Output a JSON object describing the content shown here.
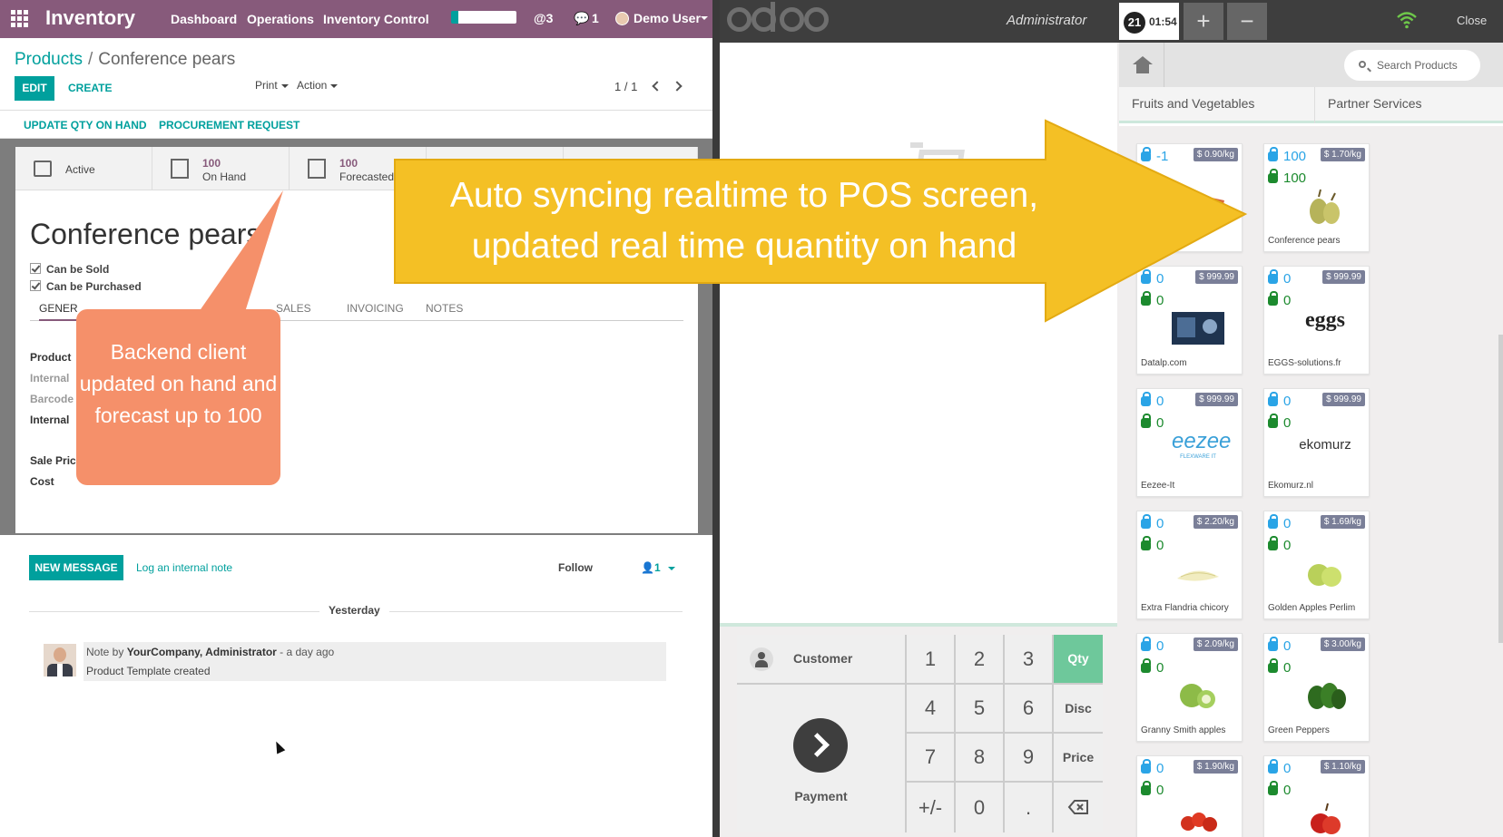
{
  "backend": {
    "app_name": "Inventory",
    "menu": [
      "Dashboard",
      "Operations",
      "Inventory Control"
    ],
    "mentions": "@3",
    "messages": "1",
    "user": "Demo User",
    "breadcrumb": {
      "parent": "Products",
      "separator": "/",
      "current": "Conference pears"
    },
    "buttons": {
      "edit": "EDIT",
      "create": "CREATE",
      "print": "Print",
      "action": "Action"
    },
    "pager": "1 / 1",
    "actions": {
      "update_qty": "UPDATE QTY ON HAND",
      "procurement": "PROCUREMENT REQUEST"
    },
    "smart_buttons": {
      "active": "Active",
      "on_hand_value": "100",
      "on_hand_label": "On Hand",
      "forecast_value": "100",
      "forecast_label": "Forecasted"
    },
    "product_name": "Conference pears",
    "checkboxes": {
      "sold": "Can be Sold",
      "purchased": "Can be Purchased"
    },
    "tabs": {
      "general": "GENER",
      "sales": "SALES",
      "invoicing": "INVOICING",
      "notes": "NOTES"
    },
    "fields": {
      "product": "Product",
      "internal": "Internal",
      "barcode": "Barcode",
      "internal2": "Internal",
      "sale_price": "Sale Pric",
      "cost": "Cost"
    },
    "chatter": {
      "new_message": "NEW MESSAGE",
      "log_note": "Log an internal note",
      "follow": "Follow",
      "followers": "1",
      "day": "Yesterday",
      "note_prefix": "Note by ",
      "note_author": "YourCompany, Administrator",
      "note_time": " - a day ago",
      "note_body": "Product Template created"
    }
  },
  "pos": {
    "user": "Administrator",
    "order_number": "21",
    "order_time": "01:54",
    "add": "+",
    "remove": "−",
    "close": "Close",
    "search_placeholder": "Search Products",
    "categories": [
      "Fruits and Vegetables",
      "Partner Services"
    ],
    "customer": "Customer",
    "payment": "Payment",
    "keys": {
      "k1": "1",
      "k2": "2",
      "k3": "3",
      "qty": "Qty",
      "k4": "4",
      "k5": "5",
      "k6": "6",
      "disc": "Disc",
      "k7": "7",
      "k8": "8",
      "k9": "9",
      "price": "Price",
      "pm": "+/-",
      "k0": "0",
      "dot": "."
    },
    "products": [
      {
        "name": "",
        "price": "$ 0.90/kg",
        "q1": "-1",
        "q2": ""
      },
      {
        "name": "Conference pears",
        "price": "$ 1.70/kg",
        "q1": "100",
        "q2": "100"
      },
      {
        "name": "Datalp.com",
        "price": "$ 999.99",
        "q1": "0",
        "q2": "0"
      },
      {
        "name": "EGGS-solutions.fr",
        "price": "$ 999.99",
        "q1": "0",
        "q2": "0"
      },
      {
        "name": "Eezee-It",
        "price": "$ 999.99",
        "q1": "0",
        "q2": "0"
      },
      {
        "name": "Ekomurz.nl",
        "price": "$ 999.99",
        "q1": "0",
        "q2": "0"
      },
      {
        "name": "Extra Flandria chicory",
        "price": "$ 2.20/kg",
        "q1": "0",
        "q2": "0"
      },
      {
        "name": "Golden Apples Perlim",
        "price": "$ 1.69/kg",
        "q1": "0",
        "q2": "0"
      },
      {
        "name": "Granny Smith apples",
        "price": "$ 2.09/kg",
        "q1": "0",
        "q2": "0"
      },
      {
        "name": "Green Peppers",
        "price": "$ 3.00/kg",
        "q1": "0",
        "q2": "0"
      },
      {
        "name": "",
        "price": "$ 1.90/kg",
        "q1": "0",
        "q2": "0"
      },
      {
        "name": "",
        "price": "$ 1.10/kg",
        "q1": "0",
        "q2": "0"
      }
    ],
    "logos": {
      "eggs": "eggs",
      "eezee": "eezee",
      "eezee_sub": "FLEXWARE IT",
      "ekomurz": "ekomurz"
    }
  },
  "annotations": {
    "arrow_line1": "Auto syncing realtime to POS screen,",
    "arrow_line2": "updated real time quantity on hand",
    "callout": "Backend client updated on hand and forecast up to 100"
  },
  "colors": {
    "brand": "#875a7b",
    "accent": "#00a09d",
    "arrow": "#f4c025",
    "callout": "#f5906a",
    "pos_dark": "#3e3e3e",
    "qty_key": "#6ec89b"
  }
}
